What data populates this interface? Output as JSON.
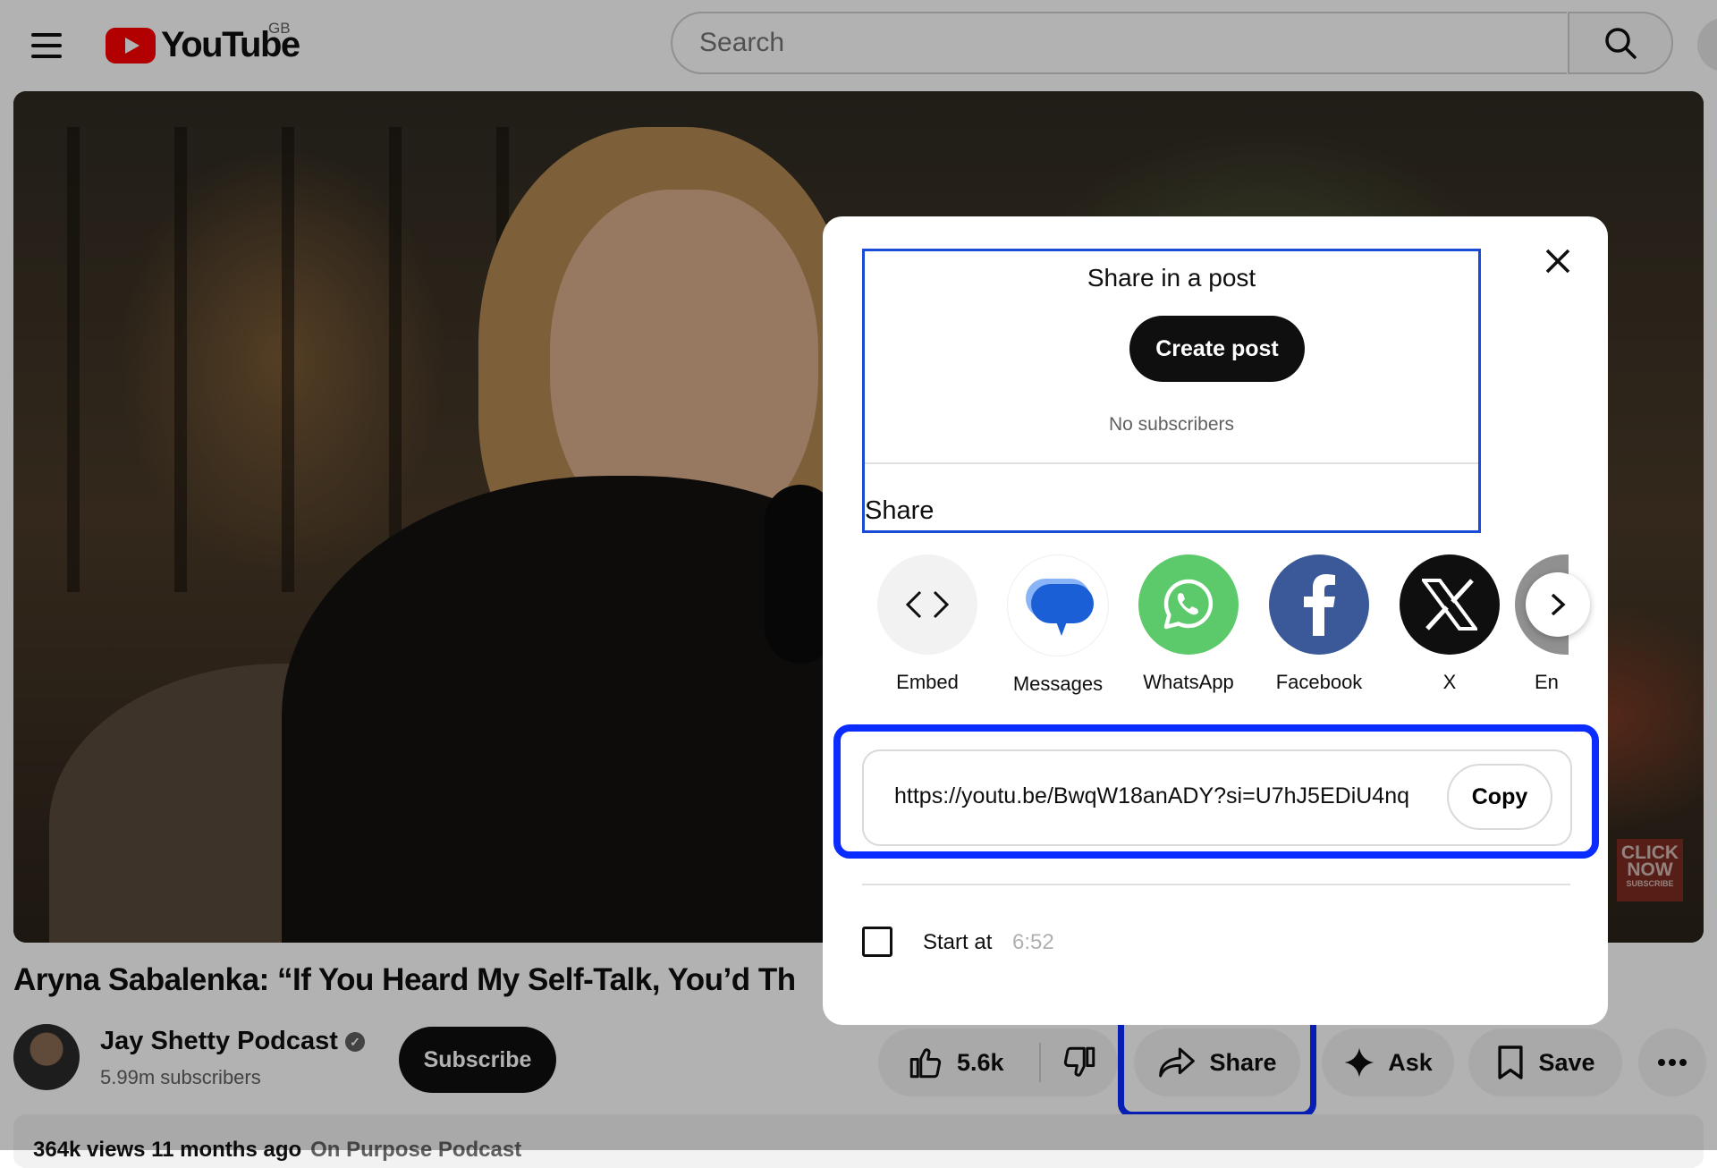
{
  "header": {
    "logo_text": "YouTube",
    "region": "GB",
    "search_placeholder": "Search"
  },
  "video": {
    "overlay_badge_line1": "CLICK",
    "overlay_badge_line2": "NOW",
    "overlay_badge_line3": "SUBSCRIBE"
  },
  "title": "Aryna Sabalenka: “If You Heard My Self-Talk, You’d Th",
  "channel": {
    "name": "Jay Shetty Podcast",
    "subscribers": "5.99m subscribers",
    "subscribe_label": "Subscribe"
  },
  "actions": {
    "likes": "5.6k",
    "share_label": "Share",
    "ask_label": "Ask",
    "save_label": "Save"
  },
  "description": {
    "meta": "364k views  11 months ago",
    "tag": "On Purpose Podcast"
  },
  "share_dialog": {
    "post_title": "Share in a post",
    "create_post_label": "Create post",
    "post_subtext": "No subscribers",
    "share_heading": "Share",
    "targets": [
      {
        "label": "Embed",
        "icon": "embed-icon"
      },
      {
        "label": "Messages",
        "icon": "messages-icon"
      },
      {
        "label": "WhatsApp",
        "icon": "whatsapp-icon"
      },
      {
        "label": "Facebook",
        "icon": "facebook-icon"
      },
      {
        "label": "X",
        "icon": "x-icon"
      },
      {
        "label": "En",
        "icon": "email-icon"
      }
    ],
    "link": "https://youtu.be/BwqW18anADY?si=U7hJ5EDiU4nq",
    "copy_label": "Copy",
    "start_at_label": "Start at",
    "start_at_time": "6:52"
  },
  "colors": {
    "highlight": "#0a2cff",
    "youtube_red": "#ff0000",
    "whatsapp": "#5cc96b",
    "facebook": "#3b5998"
  }
}
